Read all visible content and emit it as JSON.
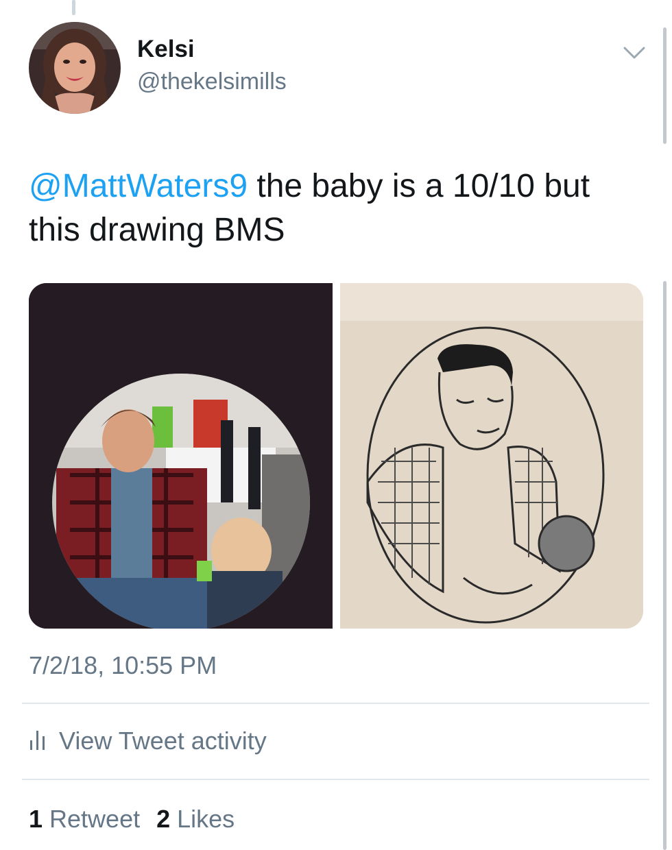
{
  "author": {
    "display_name": "Kelsi",
    "handle": "@thekelsimills",
    "avatar_icon": "profile-photo"
  },
  "tweet": {
    "mention": "@MattWaters9",
    "text_line1_rest": " the baby is a 10/10 but",
    "text_line2": "this drawing BMS"
  },
  "media": [
    {
      "description_icon": "photo-man-with-baby"
    },
    {
      "description_icon": "pencil-drawing-man-with-baby"
    }
  ],
  "timestamp": "7/2/18, 10:55 PM",
  "activity": {
    "icon": "bar-chart-icon",
    "label": "View Tweet activity"
  },
  "stats": {
    "retweets_count": "1",
    "retweets_label": "Retweet",
    "likes_count": "2",
    "likes_label": "Likes"
  },
  "colors": {
    "link_blue": "#1da1f2",
    "secondary_gray": "#657786",
    "divider": "#e1e8ed"
  }
}
